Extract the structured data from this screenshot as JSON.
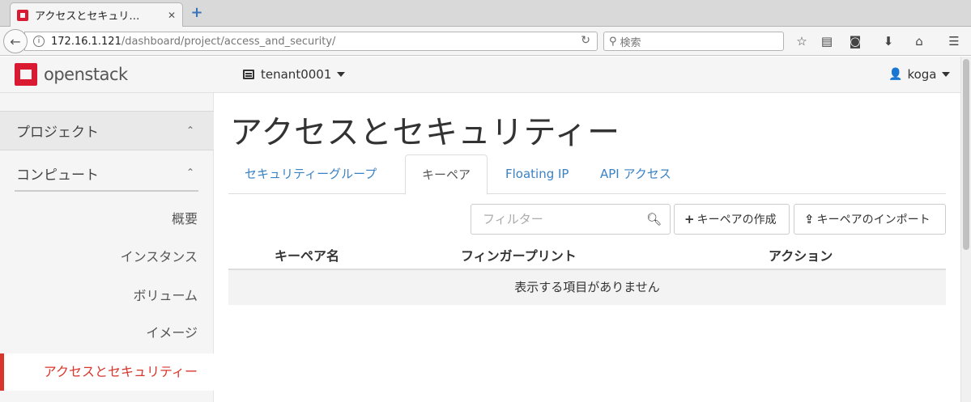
{
  "browser": {
    "tab_title": "アクセスとセキュリ…",
    "url_host": "172.16.1.121",
    "url_path": "/dashboard/project/access_and_security/",
    "search_placeholder": "検索"
  },
  "header": {
    "logo_text": "openstack",
    "tenant": "tenant0001",
    "user": "koga"
  },
  "sidebar": {
    "project_label": "プロジェクト",
    "compute_label": "コンピュート",
    "items": [
      {
        "label": "概要"
      },
      {
        "label": "インスタンス"
      },
      {
        "label": "ボリューム"
      },
      {
        "label": "イメージ"
      },
      {
        "label": "アクセスとセキュリティー"
      }
    ],
    "active_color": "#d9352d"
  },
  "main": {
    "title": "アクセスとセキュリティー",
    "tabs": [
      {
        "label": "セキュリティーグループ"
      },
      {
        "label": "キーペア"
      },
      {
        "label": "Floating IP"
      },
      {
        "label": "API アクセス"
      }
    ],
    "filter_placeholder": "フィルター",
    "create_button": "キーペアの作成",
    "import_button": "キーペアのインポート",
    "columns": [
      "キーペア名",
      "フィンガープリント",
      "アクション"
    ],
    "empty_message": "表示する項目がありません",
    "link_color": "#3b82c4"
  }
}
